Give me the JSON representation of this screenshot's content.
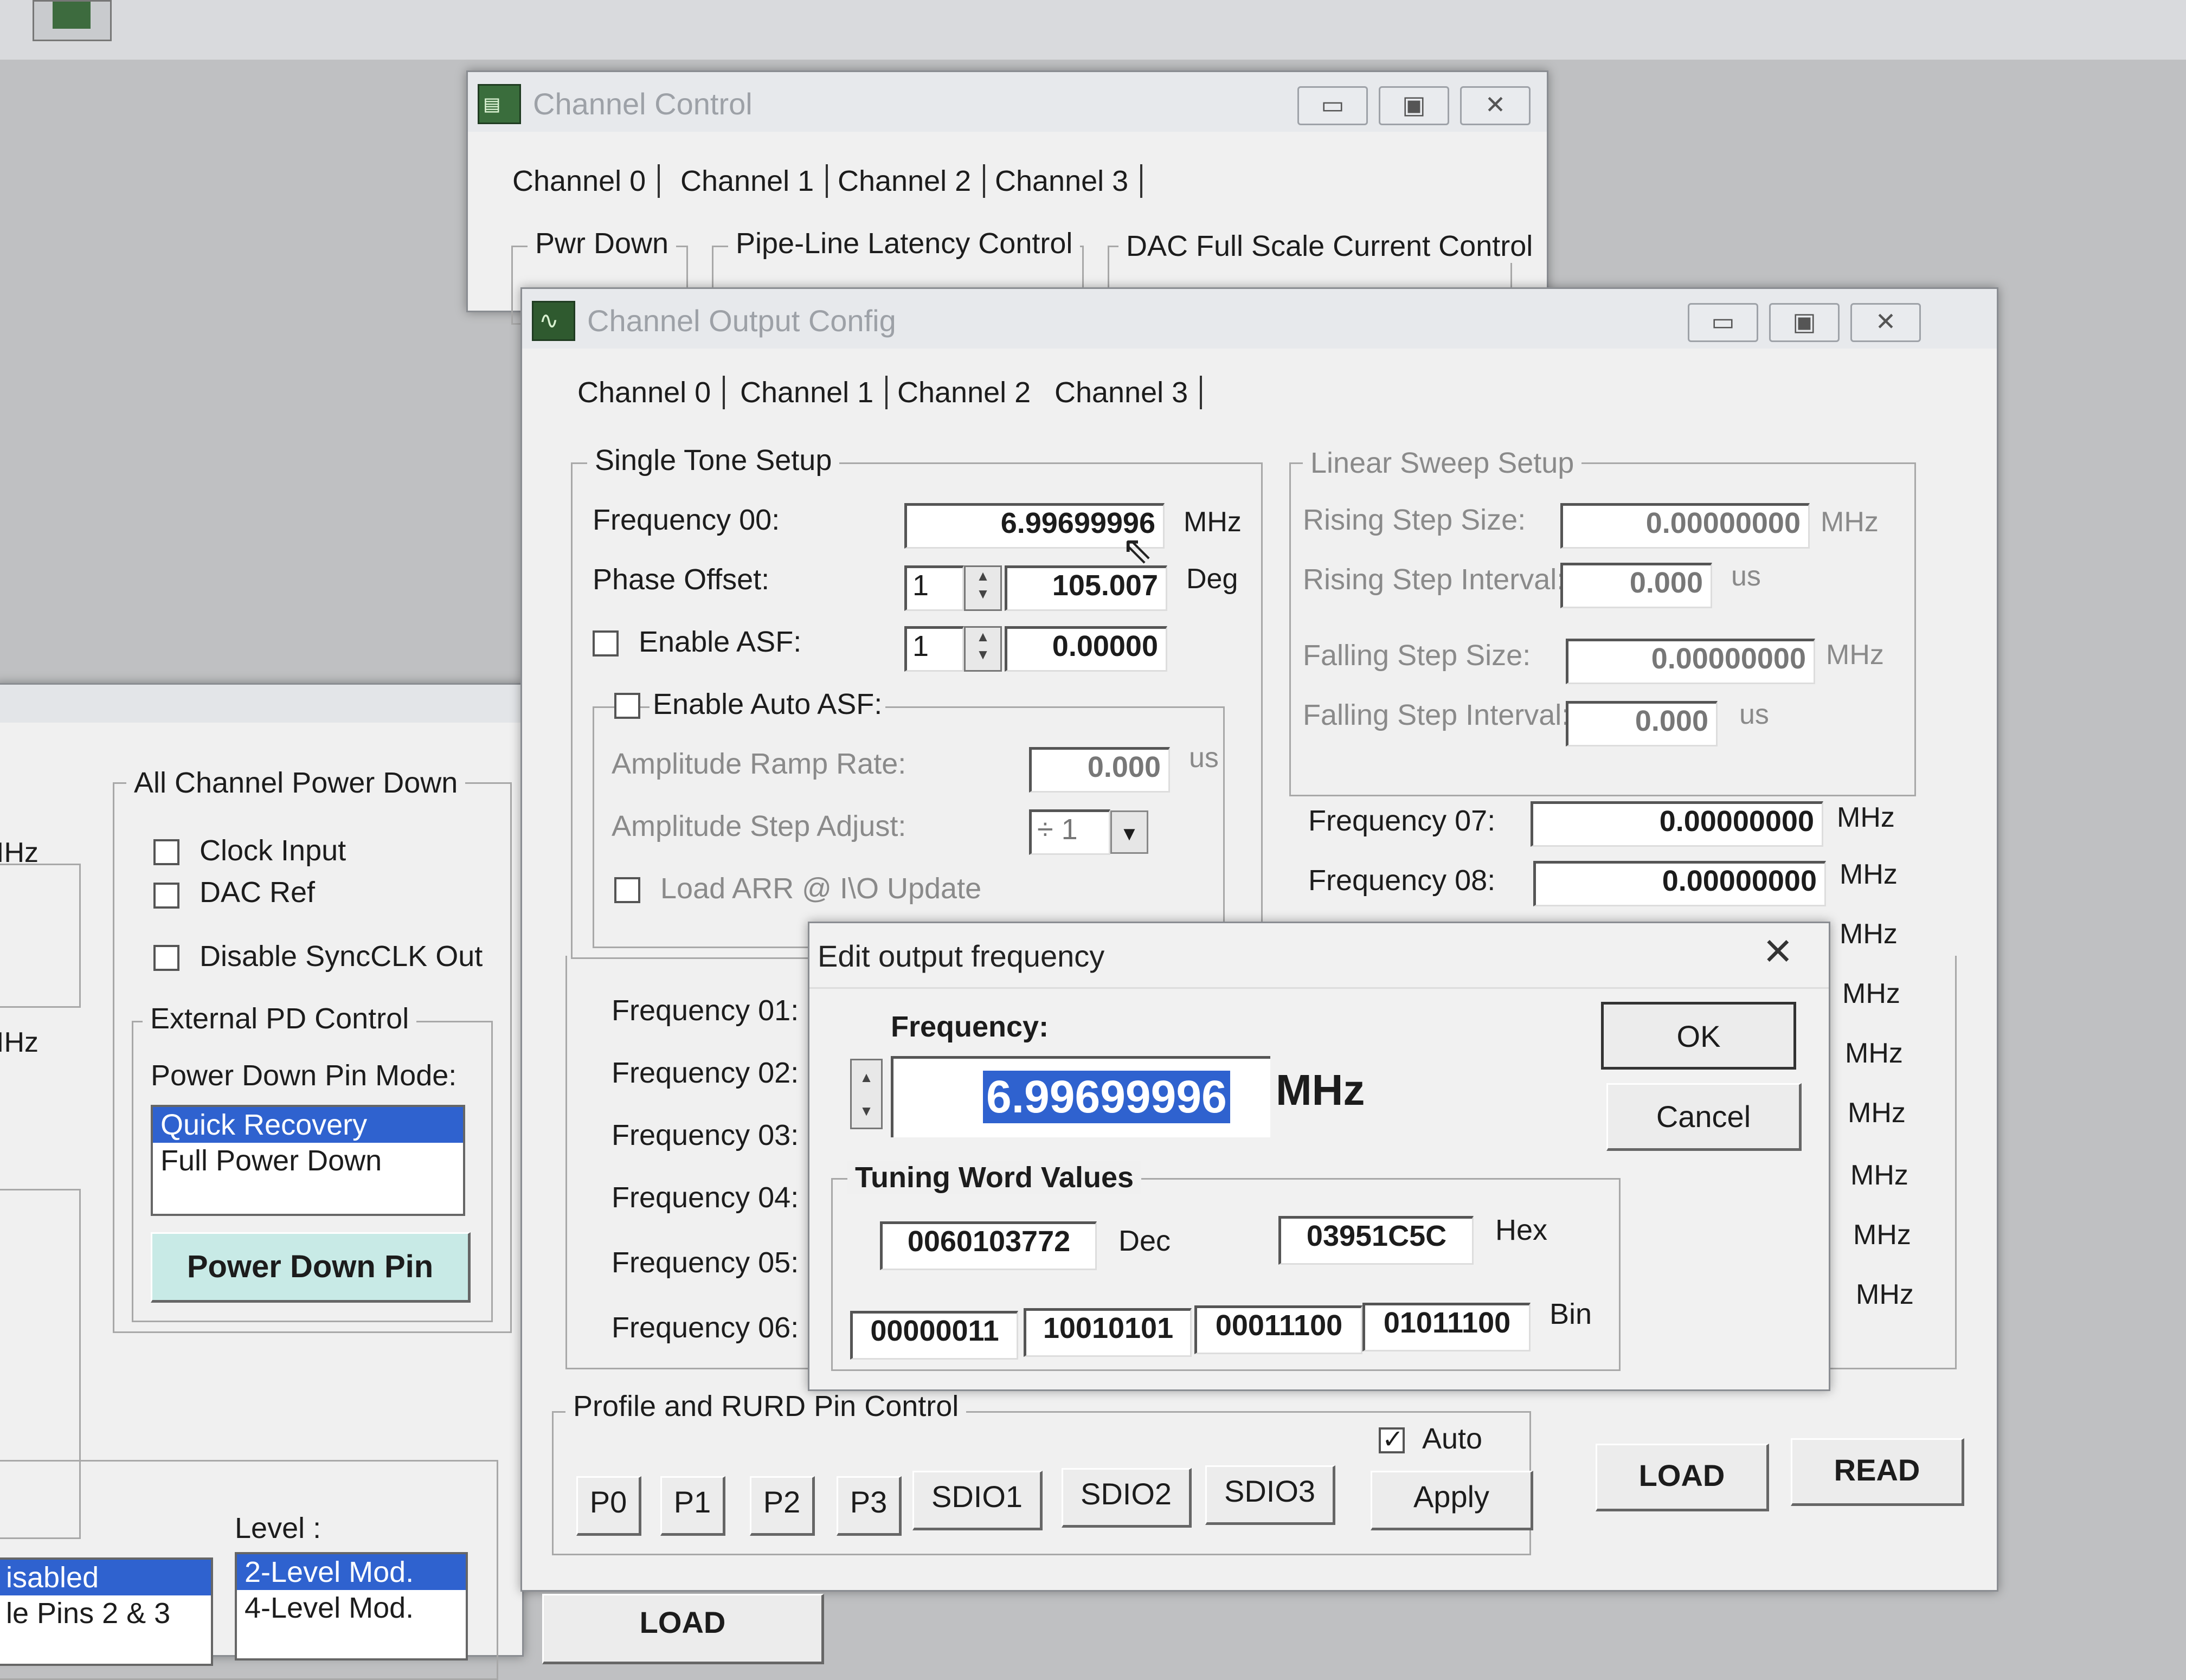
{
  "channel_control": {
    "title": "Channel Control",
    "tabs": [
      "Channel 0",
      "Channel 1",
      "Channel 2",
      "Channel 3"
    ],
    "groups": [
      "Pwr Down",
      "Pipe-Line Latency Control",
      "DAC Full Scale Current Control"
    ]
  },
  "left_panel": {
    "unit_labels": [
      "IHz",
      "IHz"
    ],
    "all_channel_power_down": "All Channel Power Down",
    "checkboxes": [
      {
        "label": "Clock Input",
        "checked": false
      },
      {
        "label": "DAC Ref",
        "checked": false
      },
      {
        "label": "Disable SyncCLK Out",
        "checked": false
      }
    ],
    "external_pd_control": "External PD Control",
    "power_down_pin_mode": "Power Down Pin Mode:",
    "modes": [
      "Quick Recovery",
      "Full Power Down"
    ],
    "power_down_pin_button": "Power Down Pin",
    "level_label": "Level :",
    "bottom_left_items": [
      "isabled",
      "le Pins 2 & 3"
    ],
    "level_items": [
      "2-Level Mod.",
      "4-Level Mod."
    ]
  },
  "output_config": {
    "title": "Channel Output Config",
    "tabs": [
      "Channel 0",
      "Channel 1",
      "Channel 2",
      "Channel 3"
    ],
    "single_tone": {
      "group": "Single Tone Setup",
      "frequency00_label": "Frequency 00:",
      "frequency00_value": "6.99699996",
      "mhz": "MHz",
      "phase_offset_label": "Phase Offset:",
      "phase_spin": "1",
      "phase_value": "105.007",
      "deg": "Deg",
      "enable_asf_label": "Enable ASF:",
      "asf_spin": "1",
      "asf_value": "0.00000",
      "enable_auto_asf": "Enable Auto ASF:",
      "ramp_rate_label": "Amplitude Ramp Rate:",
      "ramp_rate_value": "0.000",
      "us": "us",
      "step_adjust_label": "Amplitude Step Adjust:",
      "step_adjust_value": "÷ 1",
      "load_arr": "Load ARR @ I\\O Update"
    },
    "linear_sweep": {
      "group": "Linear Sweep Setup",
      "rising_step_size_label": "Rising Step Size:",
      "rising_step_size": "0.00000000",
      "rising_step_interval_label": "Rising Step Interval:",
      "rising_step_interval": "0.000",
      "falling_step_size_label": "Falling Step Size:",
      "falling_step_size": "0.00000000",
      "falling_step_interval_label": "Falling Step Interval:",
      "falling_step_interval": "0.000",
      "mhz": "MHz",
      "us": "us"
    },
    "frequency07_label": "Frequency 07:",
    "frequency07_value": "0.00000000",
    "frequency08_label": "Frequency 08:",
    "frequency08_value": "0.00000000",
    "freq_labels": [
      "Frequency 01:",
      "Frequency 02:",
      "Frequency 03:",
      "Frequency 04:",
      "Frequency 05:",
      "Frequency 06:"
    ],
    "right_mhz": [
      "MHz",
      "MHz",
      "MHz",
      "MHz",
      "MHz",
      "MHz",
      "MHz"
    ],
    "profile": {
      "group": "Profile and RURD Pin Control",
      "buttons": [
        "P0",
        "P1",
        "P2",
        "P3",
        "SDIO1",
        "SDIO2",
        "SDIO3"
      ],
      "auto_label": "Auto",
      "auto_checked": true,
      "apply": "Apply"
    },
    "load": "LOAD",
    "read": "READ"
  },
  "dialog": {
    "title": "Edit output frequency",
    "close": "×",
    "frequency_label": "Frequency:",
    "frequency_value": "6.99699996",
    "unit": "MHz",
    "ok": "OK",
    "cancel": "Cancel",
    "tuning_group": "Tuning Word Values",
    "dec_value": "0060103772",
    "dec_label": "Dec",
    "hex_value": "03951C5C",
    "hex_label": "Hex",
    "bin_values": [
      "00000011",
      "10010101",
      "00011100",
      "01011100"
    ],
    "bin_label": "Bin"
  },
  "bottom": {
    "load_partial": "LOAD"
  }
}
